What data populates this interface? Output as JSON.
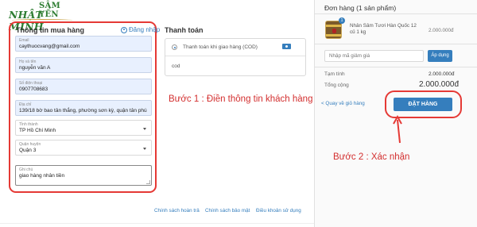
{
  "logo": {
    "line1": "SÂM YẾN",
    "line2": "NHẬT MINH"
  },
  "customer_form": {
    "title": "Thông tin mua hàng",
    "login_link": "Đăng nhập",
    "fields": {
      "email": {
        "label": "Email",
        "value": "caythuocvang@gmail.com"
      },
      "name": {
        "label": "Họ và tên",
        "value": "nguyễn văn A"
      },
      "phone": {
        "label": "Số điện thoại",
        "value": "0907708683"
      },
      "address": {
        "label": "Địa chỉ",
        "value": "139/18 bờ bao tân thắng, phường sơn kỳ, quận tân phú"
      },
      "province": {
        "label": "Tỉnh thành",
        "value": "TP Hồ Chí Minh"
      },
      "district": {
        "label": "Quận huyện",
        "value": "Quận 3"
      },
      "note": {
        "label": "Ghi chú",
        "value": "giao hàng nhân tiền"
      }
    }
  },
  "payment": {
    "title": "Thanh toán",
    "option_label": "Thanh toán khi giao hàng (COD)",
    "option_desc": "cod"
  },
  "annotations": {
    "step1": "Bước 1 : Điền thông tin khách hàng",
    "step2": "Bước 2 : Xác nhận"
  },
  "policies": [
    "Chính sách hoàn trả",
    "Chính sách bảo mật",
    "Điều khoản sử dụng"
  ],
  "order": {
    "title": "Đơn hàng (1 sản phẩm)",
    "item": {
      "qty_badge": "1",
      "name": "Nhân Sâm Tươi Hàn Quốc 12 củ 1 kg",
      "price": "2.000.000đ"
    },
    "coupon_placeholder": "Nhập mã giảm giá",
    "apply_label": "Áp dụng",
    "subtotal_label": "Tạm tính",
    "subtotal_value": "2.000.000đ",
    "total_label": "Tổng cộng",
    "total_value": "2.000.000đ",
    "back_label": "< Quay về giỏ hàng",
    "order_button": "ĐẶT HÀNG"
  },
  "colors": {
    "accent": "#357ebd",
    "annotation": "#e53935",
    "brand_green": "#2e7d32"
  }
}
